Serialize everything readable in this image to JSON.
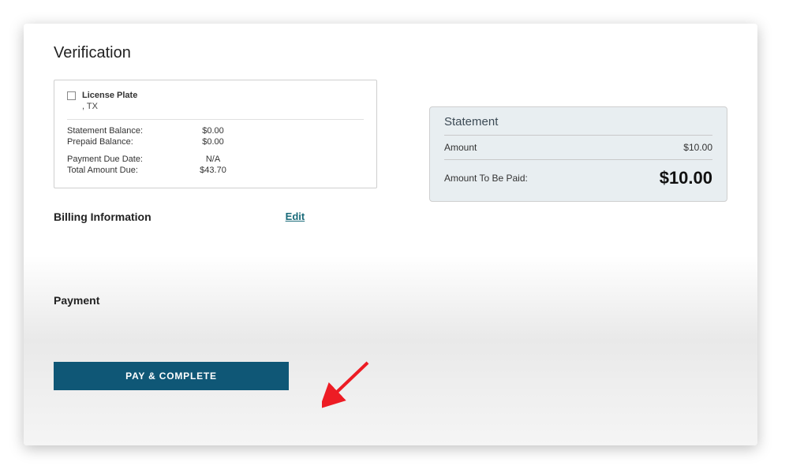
{
  "page_title": "Verification",
  "verify_box": {
    "license_plate_label": "License Plate",
    "license_plate_sub": ", TX",
    "rows": [
      {
        "label": "Statement Balance:",
        "value": "$0.00"
      },
      {
        "label": "Prepaid Balance:",
        "value": "$0.00"
      }
    ],
    "rows2": [
      {
        "label": "Payment Due Date:",
        "value": "N/A"
      },
      {
        "label": "Total Amount Due:",
        "value": "$43.70"
      }
    ]
  },
  "statement": {
    "title": "Statement",
    "amount_label": "Amount",
    "amount_value": "$10.00",
    "to_be_paid_label": "Amount To Be Paid:",
    "to_be_paid_value": "$10.00"
  },
  "billing_section_title": "Billing Information",
  "edit_label": "Edit",
  "payment_section_title": "Payment",
  "pay_button_label": "PAY & COMPLETE"
}
